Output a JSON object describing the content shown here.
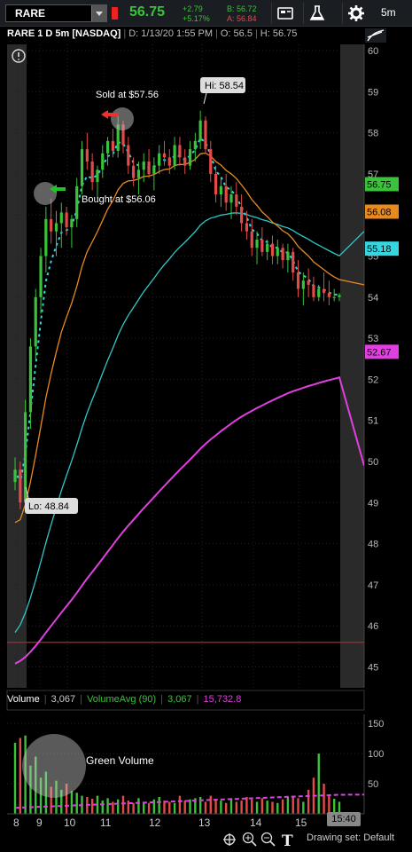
{
  "toolbar": {
    "symbol": "RARE",
    "last": "56.75",
    "change_abs": "+2.79",
    "change_pct": "+5.17%",
    "bid": "B: 56.72",
    "ask": "A: 56.84",
    "timeframe": "5m",
    "icons": [
      "card-icon",
      "flask-icon",
      "gear-icon"
    ]
  },
  "header": {
    "title": "RARE 1 D 5m [NASDAQ]",
    "datetime": "D: 1/13/20 1:55 PM",
    "open": "O: 56.5",
    "high": "H: 56.75"
  },
  "annotations": {
    "sold": "Sold at $57.56",
    "bought": "Bought at $56.06",
    "hi": "Hi: 58.54",
    "lo": "Lo: 48.84",
    "green_volume": "Green Volume"
  },
  "colors": {
    "up": "#3ac23a",
    "down": "#e34a4a",
    "ema_fast": "#35d6e0",
    "ema_mid": "#e88a1e",
    "ema_slow": "#30c8c8",
    "ema_long": "#e040e0",
    "hline": "#b4262a",
    "vol_avg": "#e040e0"
  },
  "volume": {
    "label": "Volume",
    "value": "3,067",
    "avg_label": "VolumeAvg (90)",
    "avg_value": "3,067",
    "other_value": "15,732.8",
    "time_tag": "15:40"
  },
  "footer": {
    "drawing_set": "Drawing set: Default"
  },
  "chart_data": {
    "type": "line",
    "price_axis": {
      "ylim": [
        44.5,
        60.5
      ],
      "ticks": [
        45,
        46,
        47,
        48,
        49,
        50,
        51,
        52,
        53,
        54,
        55,
        56,
        57,
        58,
        59,
        60
      ]
    },
    "price_tags": [
      {
        "value": "56.75",
        "color": "#3ac23a"
      },
      {
        "value": "56.08",
        "color": "#e88a1e"
      },
      {
        "value": "55.18",
        "color": "#35d6e0"
      },
      {
        "value": "52.67",
        "color": "#e040e0"
      }
    ],
    "x_ticks": [
      "8",
      "9",
      "10",
      "11",
      "12",
      "13",
      "14",
      "15"
    ],
    "volume_axis": {
      "ylim": [
        0,
        160
      ],
      "ticks": [
        50,
        100,
        150
      ]
    },
    "horizontal_line": 45.6,
    "hi": 58.54,
    "lo": 48.84,
    "candles": [
      [
        49.5,
        50.1,
        49.3,
        49.8
      ],
      [
        49.8,
        50.0,
        48.84,
        49.0
      ],
      [
        49.0,
        51.5,
        49.0,
        51.2
      ],
      [
        51.2,
        53.0,
        50.8,
        52.8
      ],
      [
        52.8,
        54.2,
        52.5,
        54.0
      ],
      [
        54.0,
        55.2,
        53.6,
        55.0
      ],
      [
        55.0,
        56.2,
        54.6,
        55.9
      ],
      [
        55.9,
        56.4,
        55.3,
        55.6
      ],
      [
        55.6,
        56.1,
        55.0,
        55.8
      ],
      [
        55.8,
        56.3,
        55.2,
        56.06
      ],
      [
        56.06,
        56.2,
        55.5,
        55.7
      ],
      [
        55.7,
        56.0,
        55.2,
        55.9
      ],
      [
        55.9,
        56.9,
        55.7,
        56.7
      ],
      [
        56.7,
        57.8,
        56.5,
        57.6
      ],
      [
        57.6,
        58.0,
        57.1,
        57.3
      ],
      [
        57.3,
        57.5,
        56.6,
        56.8
      ],
      [
        56.8,
        57.2,
        56.4,
        57.1
      ],
      [
        57.1,
        57.7,
        56.9,
        57.5
      ],
      [
        57.5,
        57.9,
        57.2,
        57.8
      ],
      [
        57.8,
        58.1,
        57.4,
        57.56
      ],
      [
        57.56,
        58.4,
        57.4,
        58.2
      ],
      [
        58.2,
        58.3,
        57.5,
        57.7
      ],
      [
        57.7,
        57.9,
        57.0,
        57.2
      ],
      [
        57.2,
        57.4,
        56.7,
        56.9
      ],
      [
        56.9,
        57.3,
        56.5,
        57.1
      ],
      [
        57.1,
        57.5,
        56.8,
        57.3
      ],
      [
        57.3,
        57.6,
        56.9,
        57.0
      ],
      [
        57.0,
        57.4,
        56.6,
        57.2
      ],
      [
        57.2,
        57.7,
        57.0,
        57.5
      ],
      [
        57.5,
        57.8,
        57.2,
        57.4
      ],
      [
        57.4,
        57.6,
        57.0,
        57.2
      ],
      [
        57.2,
        57.9,
        57.1,
        57.7
      ],
      [
        57.7,
        57.9,
        57.2,
        57.4
      ],
      [
        57.4,
        57.6,
        57.0,
        57.2
      ],
      [
        57.2,
        57.8,
        57.1,
        57.6
      ],
      [
        57.6,
        58.0,
        57.3,
        57.8
      ],
      [
        57.8,
        58.54,
        57.6,
        58.3
      ],
      [
        58.3,
        58.4,
        57.5,
        57.6
      ],
      [
        57.6,
        57.8,
        56.8,
        57.0
      ],
      [
        57.0,
        57.2,
        56.3,
        56.5
      ],
      [
        56.5,
        56.9,
        56.2,
        56.7
      ],
      [
        56.7,
        57.0,
        56.1,
        56.3
      ],
      [
        56.3,
        56.7,
        55.9,
        56.5
      ],
      [
        56.5,
        56.8,
        56.0,
        56.2
      ],
      [
        56.2,
        56.5,
        55.6,
        55.8
      ],
      [
        55.8,
        56.1,
        55.4,
        55.6
      ],
      [
        55.6,
        55.9,
        55.0,
        55.2
      ],
      [
        55.2,
        55.6,
        54.8,
        55.4
      ],
      [
        55.4,
        55.7,
        55.0,
        55.1
      ],
      [
        55.1,
        55.4,
        54.9,
        55.3
      ],
      [
        55.3,
        55.5,
        54.8,
        55.0
      ],
      [
        55.0,
        55.4,
        54.8,
        55.2
      ],
      [
        55.2,
        55.3,
        54.7,
        54.9
      ],
      [
        54.9,
        55.3,
        54.6,
        55.1
      ],
      [
        55.1,
        55.2,
        54.4,
        54.6
      ],
      [
        54.6,
        54.9,
        54.0,
        54.2
      ],
      [
        54.2,
        54.6,
        53.8,
        54.4
      ],
      [
        54.4,
        54.7,
        54.0,
        54.3
      ],
      [
        54.3,
        54.5,
        53.9,
        54.0
      ],
      [
        54.0,
        54.3,
        53.9,
        54.2
      ],
      [
        54.2,
        54.6,
        53.9,
        54.1
      ],
      [
        54.1,
        54.4,
        53.8,
        54.0
      ],
      [
        54.0,
        54.2,
        53.9,
        54.0
      ],
      [
        54.0,
        54.1,
        53.9,
        54.05
      ]
    ],
    "volume_bars": [
      118,
      126,
      130,
      80,
      95,
      60,
      70,
      45,
      55,
      40,
      50,
      38,
      35,
      30,
      28,
      25,
      30,
      22,
      26,
      20,
      24,
      30,
      22,
      18,
      26,
      20,
      18,
      24,
      28,
      22,
      20,
      18,
      30,
      22,
      24,
      26,
      28,
      20,
      30,
      24,
      22,
      18,
      26,
      20,
      22,
      28,
      24,
      20,
      26,
      22,
      20,
      18,
      24,
      28,
      30,
      26,
      20,
      40,
      60,
      100,
      50,
      30,
      25,
      20
    ]
  }
}
